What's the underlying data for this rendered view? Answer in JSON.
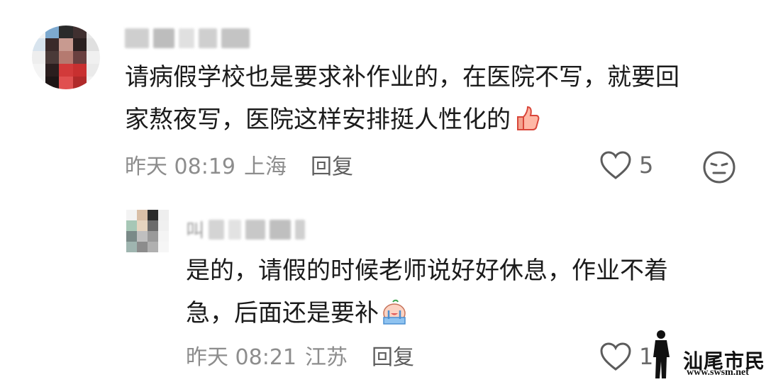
{
  "comments": [
    {
      "text_line1": "请病假学校也是要求补作业的，在医院不写，就要回",
      "text_line2": "家熬夜写，医院这样安排挺人性化的",
      "emoji": "thumbs-up-emoji",
      "time": "昨天 08:19",
      "location": "上海",
      "reply_label": "回复",
      "like_count": "5"
    },
    {
      "text_line1": "是的，请假的时候老师说好好休息，作业不着",
      "text_line2": "急，后面还是要补",
      "emoji": "crying-emoji",
      "username_prefix": "叫",
      "time": "昨天 08:21",
      "location": "江苏",
      "reply_label": "回复",
      "like_count": "1"
    }
  ],
  "watermark": {
    "title": "汕尾市民网",
    "url": "www.swsm.net"
  },
  "colors": {
    "text": "#1b1b1b",
    "meta": "#8d8d8d",
    "icon": "#6a6a6a"
  }
}
